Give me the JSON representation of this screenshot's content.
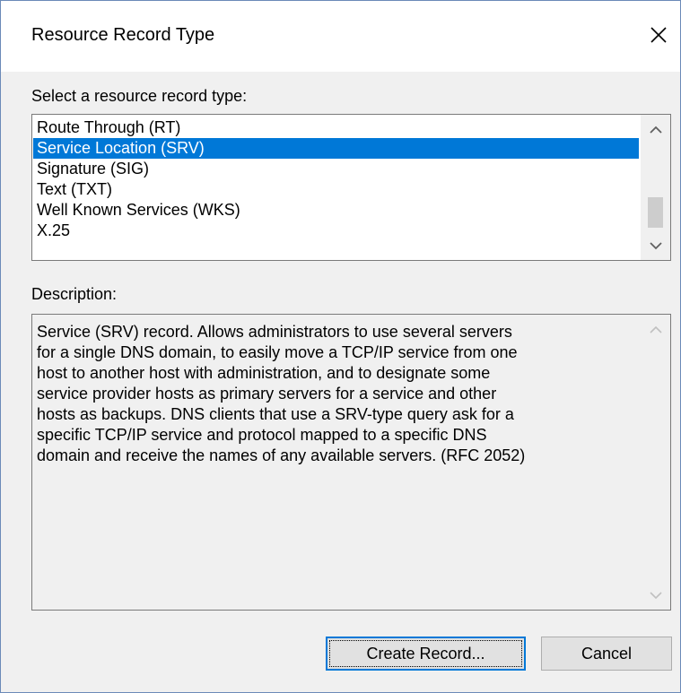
{
  "dialog": {
    "title": "Resource Record Type",
    "close_icon": "close-icon"
  },
  "record_types": {
    "label": "Select a resource record type:",
    "items": [
      "Route Through (RT)",
      "Service Location (SRV)",
      "Signature (SIG)",
      "Text (TXT)",
      "Well Known Services (WKS)",
      "X.25"
    ],
    "selected": "Service Location (SRV)"
  },
  "description": {
    "label": "Description:",
    "lines": [
      "Service (SRV) record. Allows administrators to use several servers",
      "for a single DNS domain, to easily move a TCP/IP service from one",
      "host to another host with administration, and to designate some",
      "service provider hosts as primary servers for a service and other",
      "hosts as backups. DNS clients that use a SRV-type query ask for a",
      "specific TCP/IP service and protocol mapped to a specific DNS",
      "domain and receive the names of any available servers. (RFC 2052)"
    ]
  },
  "buttons": {
    "create_label": "Create Record...",
    "cancel_label": "Cancel"
  },
  "colors": {
    "selection": "#0078d7",
    "dialog_bg": "#f0f0f0",
    "accent_border": "#0078d7"
  }
}
